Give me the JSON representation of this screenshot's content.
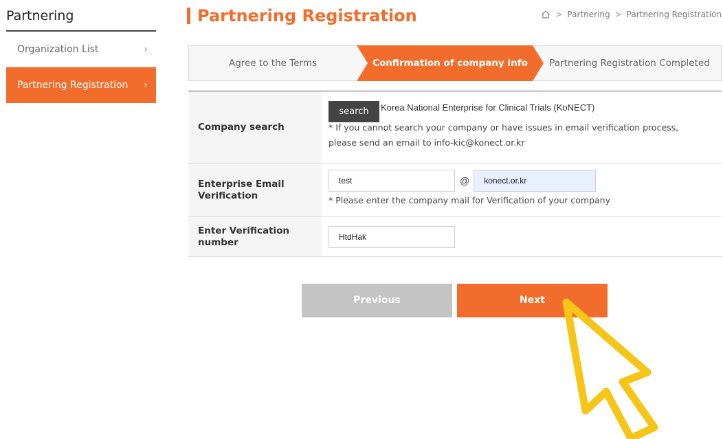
{
  "sidebar": {
    "title": "Partnering",
    "items": [
      {
        "label": "Organization List",
        "active": false
      },
      {
        "label": "Partnering Registration",
        "active": true
      }
    ]
  },
  "header": {
    "title": "Partnering Registration"
  },
  "breadcrumb": {
    "home_icon": "home-icon",
    "items": [
      "Partnering",
      "Partnering Registration"
    ]
  },
  "steps": [
    {
      "label": "Agree to the Terms",
      "active": false
    },
    {
      "label": "Confirmation of company info",
      "active": true
    },
    {
      "label": "Partnering Registration Completed",
      "active": false
    }
  ],
  "form": {
    "company_search": {
      "label": "Company search",
      "button_label": "search",
      "company_name": "Korea National Enterprise for Clinical Trials (KoNECT)",
      "note_line1": "* If you cannot search your company or have issues in email verification process,",
      "note_line2": "please send an email to info-kic@konect.or.kr"
    },
    "email": {
      "label_line1": "Enterprise Email",
      "label_line2": "Verification",
      "user_value": "test",
      "at_sign": "@",
      "domain_value": "konect.or.kr",
      "note": "* Please enter the company mail for Verification of your company"
    },
    "verification": {
      "label_line1": "Enter Verification",
      "label_line2": "number",
      "value": "HtdHak"
    }
  },
  "buttons": {
    "previous": "Previous",
    "next": "Next"
  },
  "colors": {
    "accent": "#f26d2b",
    "previous_button": "#c4c4c4",
    "cursor_overlay": "#f5c518"
  }
}
